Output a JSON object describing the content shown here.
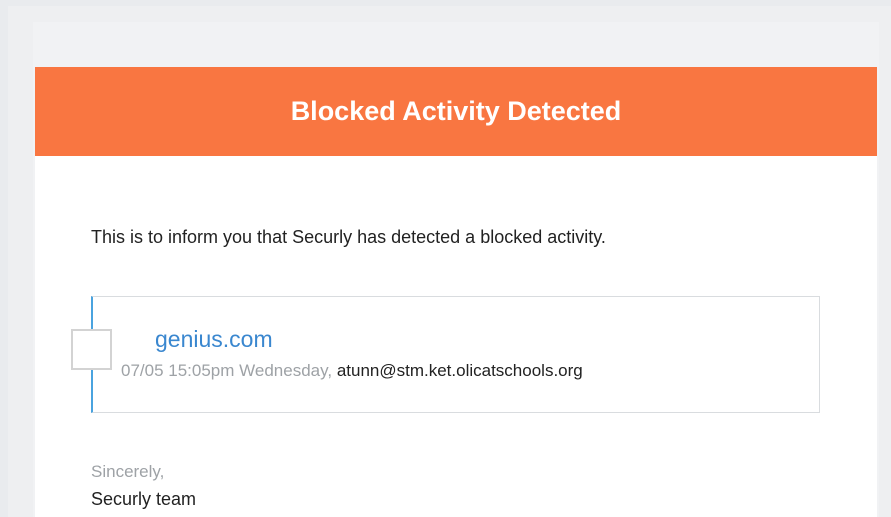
{
  "email": {
    "header": {
      "title": "Blocked Activity Detected",
      "color": "#f97641"
    },
    "intro": "This is to inform you that Securly has detected a blocked activity.",
    "activity": {
      "domain": "genius.com",
      "time": "07/05 15:05pm Wednesday,",
      "user": "atunn@stm.ket.olicatschools.org",
      "favicon": "broken-image-icon"
    },
    "closing": "Sincerely,",
    "signature": "Securly team"
  }
}
